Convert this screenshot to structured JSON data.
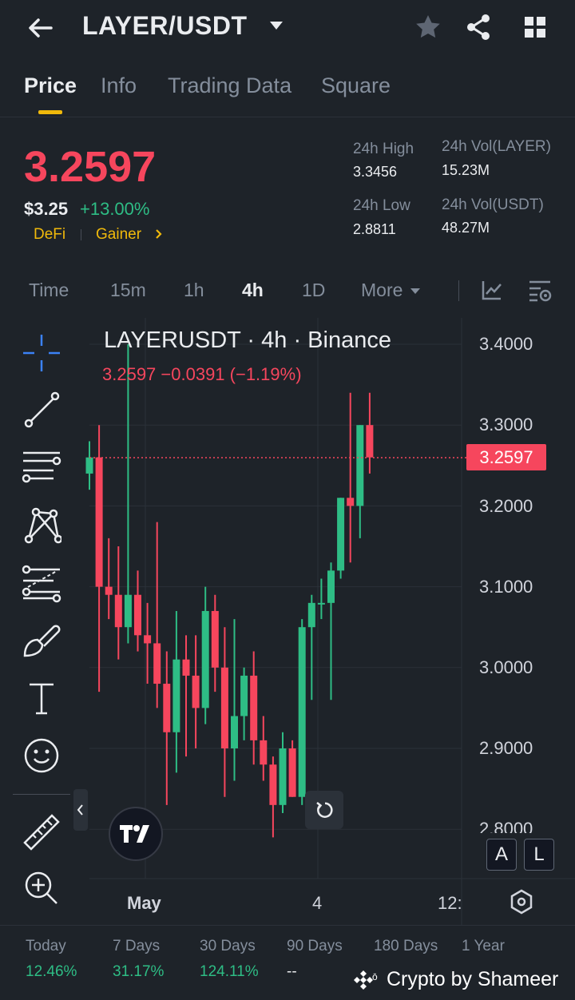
{
  "header": {
    "pair": "LAYER/USDT",
    "icons": [
      "back-arrow-icon",
      "caret-down-icon",
      "star-icon",
      "share-icon",
      "grid-icon"
    ]
  },
  "tabs": [
    "Price",
    "Info",
    "Trading Data",
    "Square"
  ],
  "price": {
    "last": "3.2597",
    "usd": "$3.25",
    "change": "+13.00%",
    "tags": [
      "DeFi",
      "Gainer"
    ],
    "stats": {
      "high_label": "24h High",
      "high": "3.3456",
      "low_label": "24h Low",
      "low": "2.8811",
      "vol_base_label": "24h Vol(LAYER)",
      "vol_base": "15.23M",
      "vol_quote_label": "24h Vol(USDT)",
      "vol_quote": "48.27M"
    },
    "colors": {
      "down": "#F6465D",
      "up": "#2EBD85",
      "accent": "#F0B90B"
    }
  },
  "intervals": {
    "items": [
      "Time",
      "15m",
      "1h",
      "4h",
      "1D",
      "More"
    ],
    "selected": "4h"
  },
  "chart": {
    "title": "LAYERUSDT · 4h · Binance",
    "ohlc": "3.2597  −0.0391 (−1.19%)",
    "last_tag": "3.2597",
    "y_ticks": [
      "3.4000",
      "3.3000",
      "3.2000",
      "3.1000",
      "3.0000",
      "2.9000",
      "2.8000"
    ],
    "x_ticks": [
      "May",
      "4",
      "12:"
    ],
    "buttons": {
      "a": "A",
      "l": "L"
    }
  },
  "chart_data": {
    "type": "candlestick",
    "title": "LAYERUSDT · 4h · Binance",
    "ylim": [
      2.78,
      3.42
    ],
    "x_ticks": [
      "May",
      "4",
      "12:"
    ],
    "last_price": 3.2597,
    "candles": [
      {
        "o": 3.24,
        "h": 3.28,
        "l": 3.22,
        "c": 3.26
      },
      {
        "o": 3.26,
        "h": 3.3,
        "l": 2.97,
        "c": 3.1
      },
      {
        "o": 3.1,
        "h": 3.16,
        "l": 3.06,
        "c": 3.09
      },
      {
        "o": 3.09,
        "h": 3.15,
        "l": 3.01,
        "c": 3.05
      },
      {
        "o": 3.05,
        "h": 3.4,
        "l": 3.03,
        "c": 3.09
      },
      {
        "o": 3.09,
        "h": 3.12,
        "l": 3.02,
        "c": 3.04
      },
      {
        "o": 3.04,
        "h": 3.08,
        "l": 2.98,
        "c": 3.03
      },
      {
        "o": 3.03,
        "h": 3.18,
        "l": 2.95,
        "c": 2.98
      },
      {
        "o": 2.98,
        "h": 3.02,
        "l": 2.83,
        "c": 2.92
      },
      {
        "o": 2.92,
        "h": 3.07,
        "l": 2.87,
        "c": 3.01
      },
      {
        "o": 3.01,
        "h": 3.04,
        "l": 2.89,
        "c": 2.99
      },
      {
        "o": 2.99,
        "h": 3.04,
        "l": 2.9,
        "c": 2.95
      },
      {
        "o": 2.95,
        "h": 3.1,
        "l": 2.93,
        "c": 3.07
      },
      {
        "o": 3.07,
        "h": 3.09,
        "l": 2.97,
        "c": 3.0
      },
      {
        "o": 3.0,
        "h": 3.05,
        "l": 2.84,
        "c": 2.9
      },
      {
        "o": 2.9,
        "h": 3.06,
        "l": 2.86,
        "c": 2.94
      },
      {
        "o": 2.94,
        "h": 3.0,
        "l": 2.91,
        "c": 2.99
      },
      {
        "o": 2.99,
        "h": 3.02,
        "l": 2.88,
        "c": 2.91
      },
      {
        "o": 2.91,
        "h": 2.94,
        "l": 2.86,
        "c": 2.88
      },
      {
        "o": 2.88,
        "h": 2.89,
        "l": 2.79,
        "c": 2.83
      },
      {
        "o": 2.83,
        "h": 2.92,
        "l": 2.82,
        "c": 2.9
      },
      {
        "o": 2.9,
        "h": 2.91,
        "l": 2.84,
        "c": 2.84
      },
      {
        "o": 2.84,
        "h": 3.06,
        "l": 2.83,
        "c": 3.05
      },
      {
        "o": 3.05,
        "h": 3.09,
        "l": 2.96,
        "c": 3.08
      },
      {
        "o": 3.08,
        "h": 3.11,
        "l": 3.06,
        "c": 3.08
      },
      {
        "o": 3.08,
        "h": 3.13,
        "l": 2.96,
        "c": 3.12
      },
      {
        "o": 3.12,
        "h": 3.21,
        "l": 3.11,
        "c": 3.21
      },
      {
        "o": 3.21,
        "h": 3.34,
        "l": 3.13,
        "c": 3.2
      },
      {
        "o": 3.2,
        "h": 3.3,
        "l": 3.16,
        "c": 3.3
      },
      {
        "o": 3.3,
        "h": 3.34,
        "l": 3.24,
        "c": 3.26
      }
    ]
  },
  "performance": [
    {
      "label": "Today",
      "value": "12.46%"
    },
    {
      "label": "7 Days",
      "value": "31.17%"
    },
    {
      "label": "30 Days",
      "value": "124.11%"
    },
    {
      "label": "90 Days",
      "value": "--"
    },
    {
      "label": "180 Days",
      "value": ""
    },
    {
      "label": "1 Year",
      "value": ""
    }
  ],
  "watermark": "Crypto by Shameer"
}
